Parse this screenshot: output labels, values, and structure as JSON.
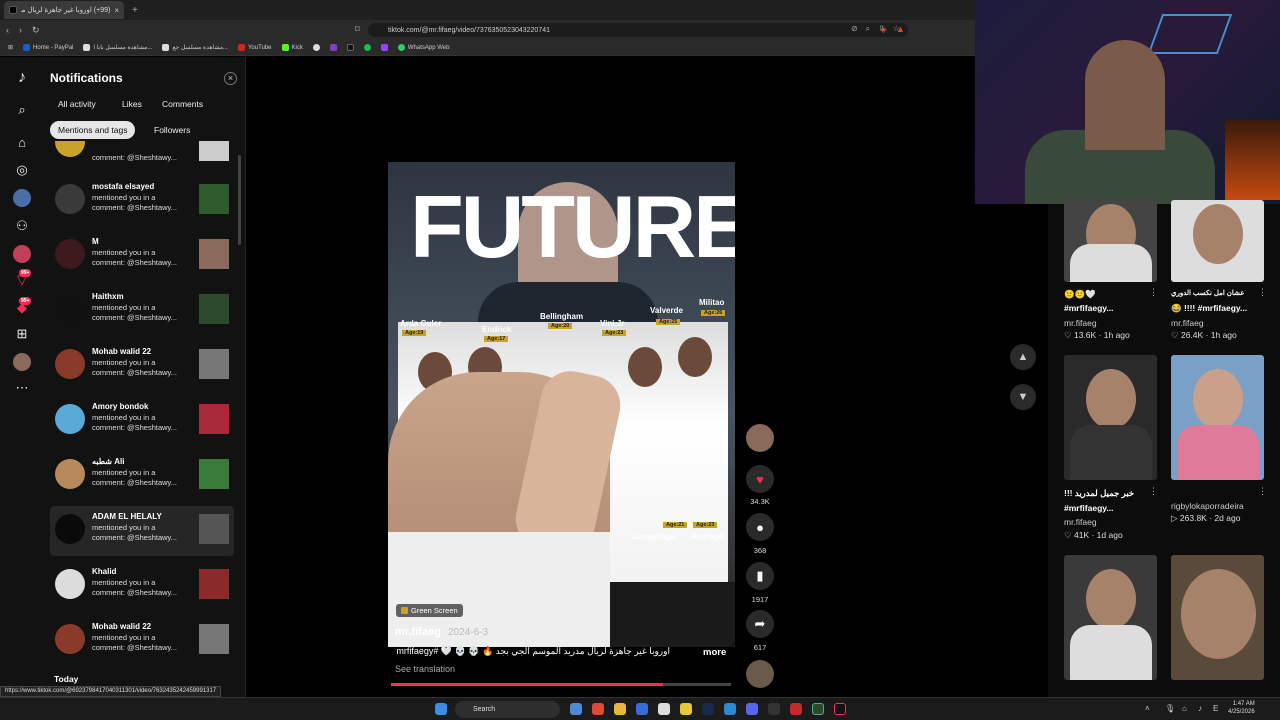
{
  "browser": {
    "tab_title": "(99+) اوروبا غير جاهزة لريال مدريد",
    "tab_close": "×",
    "new_tab": "+",
    "url": "tiktok.com/@mr.fifaeg/video/7376350523043220741",
    "bookmarks": [
      "Home - PayPal",
      "مشاهدة مسلسل بابا ا...",
      "مشاهدة مسلسل جع...",
      "YouTube",
      "Kick",
      "WhatsApp Web"
    ]
  },
  "rail": {
    "badges": [
      "99+",
      "99+"
    ]
  },
  "notifications": {
    "title": "Notifications",
    "close": "×",
    "filters": [
      "All activity",
      "Likes",
      "Comments",
      "Mentions and tags",
      "Followers"
    ],
    "selected_filter": "Mentions and tags",
    "items": [
      {
        "name": "",
        "line1": "comment: @Sheshtawy...",
        "line2": ""
      },
      {
        "name": "mostafa elsayed",
        "line1": "mentioned you in a",
        "line2": "comment: @Sheshtawy..."
      },
      {
        "name": "M",
        "line1": "mentioned you in a",
        "line2": "comment: @Sheshtawy..."
      },
      {
        "name": "Haithxm",
        "line1": "mentioned you in a",
        "line2": "comment: @Sheshtawy..."
      },
      {
        "name": "Mohab walid 22",
        "line1": "mentioned you in a",
        "line2": "comment: @Sheshtawy..."
      },
      {
        "name": "Amory bondok",
        "line1": "mentioned you in a",
        "line2": "comment: @Sheshtawy..."
      },
      {
        "name": "شطبه Ali",
        "line1": "mentioned you in a",
        "line2": "comment: @Sheshtawy..."
      },
      {
        "name": "ADAM EL HELALY",
        "line1": "mentioned you in a",
        "line2": "comment: @Sheshtawy..."
      },
      {
        "name": "Khalid",
        "line1": "mentioned you in a",
        "line2": "comment: @Sheshtawy..."
      },
      {
        "name": "Mohab walid 22",
        "line1": "mentioned you in a",
        "line2": "comment: @Sheshtawy..."
      }
    ],
    "section_today": "Today"
  },
  "video": {
    "headline": "FUTURE",
    "players": [
      "Arda Guler",
      "Endrick",
      "Bellingham",
      "Vini.Jr",
      "Valverde",
      "Militao",
      "Camavinga",
      "Rodrygo"
    ],
    "ages": [
      "Age:19",
      "Age:17",
      "Age:20",
      "Age:23",
      "Age:25",
      "Age:26",
      "Age:21",
      "Age:23"
    ],
    "effect_label": "Green Screen",
    "username": "mr.fifaeg",
    "date": "2024-6-3",
    "caption": "اوروبا غير جاهزة لريال مدريد الموسم الجي بجد 🔥 💀 💀 🤍 #mrfifaegy ...",
    "more": "more",
    "see_translation": "See translation",
    "progress_percent": 80,
    "likes": "34.3K",
    "comments": "368",
    "saves": "1917",
    "shares": "617"
  },
  "recommendations": [
    {
      "title": "🙂🙂🤍",
      "subtitle": "#mrfifaegy...",
      "user": "mr.fifaeg",
      "views": "13.6K",
      "age": "1h ago"
    },
    {
      "title": "عشان امل نكسب الدوري",
      "subtitle": "😂 !!!! #mrfifaegy...",
      "user": "mr.fifaeg",
      "views": "26.4K",
      "age": "1h ago"
    },
    {
      "title": "!!! خبر جميل لمدريد",
      "subtitle": "#mrfifaegy...",
      "user": "mr.fifaeg",
      "views": "41K",
      "age": "1d ago"
    },
    {
      "title": "",
      "subtitle": "",
      "user": "rigbylokaporradeira",
      "views": "263.8K",
      "age": "2d ago"
    }
  ],
  "status_url": "https://www.tiktok.com/@6923798417040311301/video/7632435242459991317",
  "taskbar": {
    "search": "Search",
    "time": "1:47 AM",
    "date": "4/25/2026"
  },
  "colors": {
    "accent": "#fe2c55",
    "background": "#000000",
    "panel": "#121212"
  }
}
